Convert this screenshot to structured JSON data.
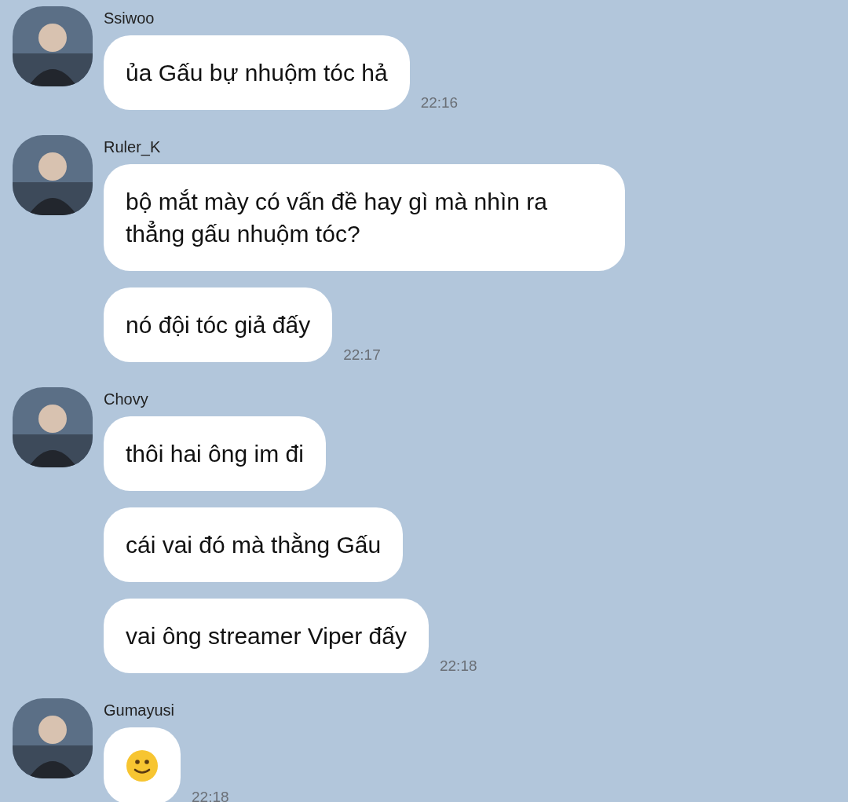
{
  "groups": [
    {
      "sender": "Ssiwoo",
      "avatar": {
        "kind": "picture"
      },
      "time": "22:16",
      "messages": [
        {
          "kind": "text",
          "text": "ủa Gấu bự nhuộm tóc hả"
        }
      ]
    },
    {
      "sender": "Ruler_K",
      "avatar": {
        "kind": "picture"
      },
      "time": "22:17",
      "messages": [
        {
          "kind": "text",
          "text": "bộ mắt mày có vấn đề hay gì mà nhìn ra thẳng gấu nhuộm tóc?"
        },
        {
          "kind": "text",
          "text": "nó đội tóc giả đấy"
        }
      ]
    },
    {
      "sender": "Chovy",
      "avatar": {
        "kind": "picture"
      },
      "time": "22:18",
      "messages": [
        {
          "kind": "text",
          "text": "thôi hai ông im đi"
        },
        {
          "kind": "text",
          "text": "cái vai đó mà thằng Gấu"
        },
        {
          "kind": "text",
          "text": "vai ông streamer Viper đấy"
        }
      ]
    },
    {
      "sender": "Gumayusi",
      "avatar": {
        "kind": "picture"
      },
      "time": "22:18",
      "messages": [
        {
          "kind": "emoji"
        }
      ]
    }
  ]
}
